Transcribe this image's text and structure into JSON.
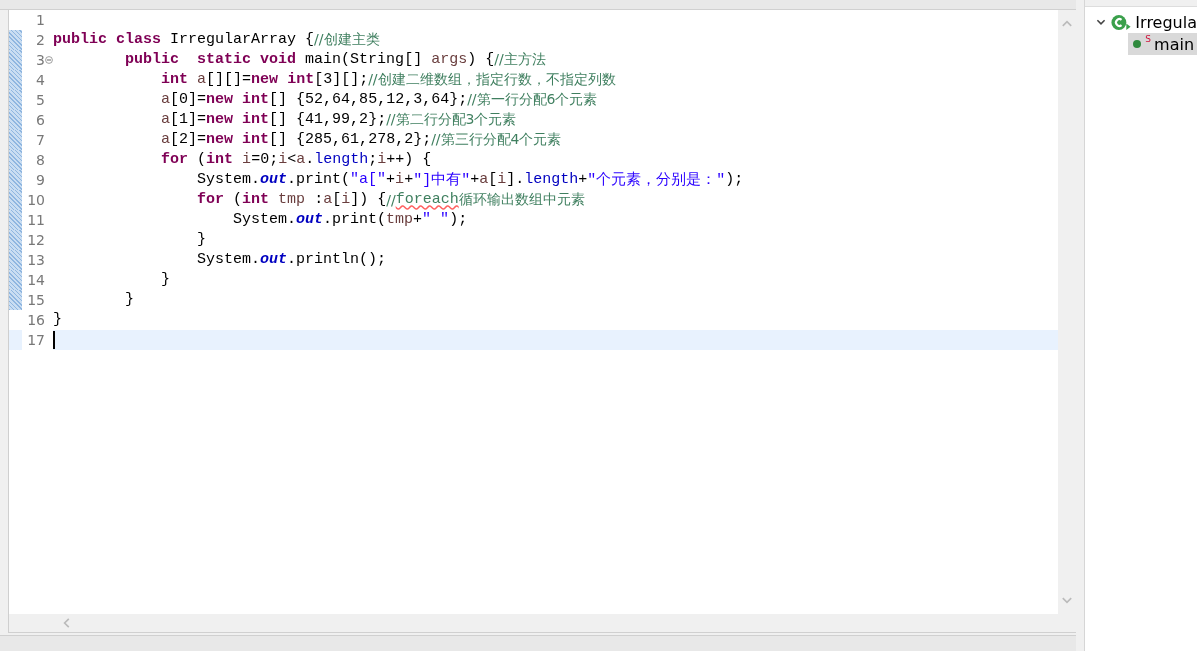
{
  "editor": {
    "lines": [
      {
        "number": "1",
        "changed": false,
        "fold": false,
        "current": false
      },
      {
        "number": "2",
        "changed": true,
        "fold": false,
        "current": false,
        "tokens": [
          {
            "kind": "keyword",
            "text": "public"
          },
          {
            "kind": "keyword",
            "text": " class"
          },
          {
            "kind": "plain",
            "text": " IrregularArray {"
          },
          {
            "kind": "comment",
            "text": "//创建主类"
          }
        ]
      },
      {
        "number": "3",
        "changed": true,
        "fold": true,
        "current": false,
        "tokens": [
          {
            "kind": "keyword",
            "text": "\t\tpublic"
          },
          {
            "kind": "keyword",
            "text": "  static"
          },
          {
            "kind": "keyword",
            "text": " void"
          },
          {
            "kind": "plain",
            "text": " main(String[] "
          },
          {
            "kind": "variable",
            "text": "args"
          },
          {
            "kind": "plain",
            "text": ") {"
          },
          {
            "kind": "comment",
            "text": "//主方法"
          }
        ]
      },
      {
        "number": "4",
        "changed": true,
        "fold": false,
        "current": false,
        "tokens": [
          {
            "kind": "keyword",
            "text": "\t\t\tint"
          },
          {
            "kind": "variable",
            "text": " a"
          },
          {
            "kind": "plain",
            "text": "[][]="
          },
          {
            "kind": "keyword",
            "text": "new"
          },
          {
            "kind": "keyword",
            "text": " int"
          },
          {
            "kind": "plain",
            "text": "[3][];"
          },
          {
            "kind": "comment",
            "text": "//创建二维数组，指定行数，不指定列数"
          }
        ]
      },
      {
        "number": "5",
        "changed": true,
        "fold": false,
        "current": false,
        "tokens": [
          {
            "kind": "variable",
            "text": "\t\t\ta"
          },
          {
            "kind": "plain",
            "text": "[0]="
          },
          {
            "kind": "keyword",
            "text": "new"
          },
          {
            "kind": "keyword",
            "text": " int"
          },
          {
            "kind": "plain",
            "text": "[] {52,64,85,12,3,64};"
          },
          {
            "kind": "comment",
            "text": "//第一行分配6个元素"
          }
        ]
      },
      {
        "number": "6",
        "changed": true,
        "fold": false,
        "current": false,
        "tokens": [
          {
            "kind": "variable",
            "text": "\t\t\ta"
          },
          {
            "kind": "plain",
            "text": "[1]="
          },
          {
            "kind": "keyword",
            "text": "new"
          },
          {
            "kind": "keyword",
            "text": " int"
          },
          {
            "kind": "plain",
            "text": "[] {41,99,2};"
          },
          {
            "kind": "comment",
            "text": "//第二行分配3个元素"
          }
        ]
      },
      {
        "number": "7",
        "changed": true,
        "fold": false,
        "current": false,
        "tokens": [
          {
            "kind": "variable",
            "text": "\t\t\ta"
          },
          {
            "kind": "plain",
            "text": "[2]="
          },
          {
            "kind": "keyword",
            "text": "new"
          },
          {
            "kind": "keyword",
            "text": " int"
          },
          {
            "kind": "plain",
            "text": "[] {285,61,278,2};"
          },
          {
            "kind": "comment",
            "text": "//第三行分配4个元素"
          }
        ]
      },
      {
        "number": "8",
        "changed": true,
        "fold": false,
        "current": false,
        "tokens": [
          {
            "kind": "keyword",
            "text": "\t\t\tfor"
          },
          {
            "kind": "plain",
            "text": " ("
          },
          {
            "kind": "keyword",
            "text": "int"
          },
          {
            "kind": "variable",
            "text": " i"
          },
          {
            "kind": "plain",
            "text": "=0;"
          },
          {
            "kind": "variable",
            "text": "i"
          },
          {
            "kind": "plain",
            "text": "<"
          },
          {
            "kind": "variable",
            "text": "a"
          },
          {
            "kind": "plain",
            "text": "."
          },
          {
            "kind": "member",
            "text": "length"
          },
          {
            "kind": "plain",
            "text": ";"
          },
          {
            "kind": "variable",
            "text": "i"
          },
          {
            "kind": "plain",
            "text": "++) {"
          }
        ]
      },
      {
        "number": "9",
        "changed": true,
        "fold": false,
        "current": false,
        "tokens": [
          {
            "kind": "plain",
            "text": "\t\t\t\tSystem."
          },
          {
            "kind": "static_field",
            "text": "out"
          },
          {
            "kind": "plain",
            "text": ".print("
          },
          {
            "kind": "string",
            "text": "\"a[\""
          },
          {
            "kind": "plain",
            "text": "+"
          },
          {
            "kind": "variable",
            "text": "i"
          },
          {
            "kind": "plain",
            "text": "+"
          },
          {
            "kind": "string",
            "text": "\"]中有\""
          },
          {
            "kind": "plain",
            "text": "+"
          },
          {
            "kind": "variable",
            "text": "a"
          },
          {
            "kind": "plain",
            "text": "["
          },
          {
            "kind": "variable",
            "text": "i"
          },
          {
            "kind": "plain",
            "text": "]."
          },
          {
            "kind": "member",
            "text": "length"
          },
          {
            "kind": "plain",
            "text": "+"
          },
          {
            "kind": "string",
            "text": "\"个元素，分别是：\""
          },
          {
            "kind": "plain",
            "text": ");"
          }
        ]
      },
      {
        "number": "10",
        "changed": true,
        "fold": false,
        "current": false,
        "tokens": [
          {
            "kind": "keyword",
            "text": "\t\t\t\tfor"
          },
          {
            "kind": "plain",
            "text": " ("
          },
          {
            "kind": "keyword",
            "text": "int"
          },
          {
            "kind": "variable",
            "text": " tmp"
          },
          {
            "kind": "plain",
            "text": " :"
          },
          {
            "kind": "variable",
            "text": "a"
          },
          {
            "kind": "plain",
            "text": "["
          },
          {
            "kind": "variable",
            "text": "i"
          },
          {
            "kind": "plain",
            "text": "]) {"
          },
          {
            "kind": "comment",
            "text": "//"
          },
          {
            "kind": "misspelled",
            "text": "foreach"
          },
          {
            "kind": "comment",
            "text": "循环输出数组中元素"
          }
        ]
      },
      {
        "number": "11",
        "changed": true,
        "fold": false,
        "current": false,
        "tokens": [
          {
            "kind": "plain",
            "text": "\t\t\t\t\tSystem."
          },
          {
            "kind": "static_field",
            "text": "out"
          },
          {
            "kind": "plain",
            "text": ".print("
          },
          {
            "kind": "variable",
            "text": "tmp"
          },
          {
            "kind": "plain",
            "text": "+"
          },
          {
            "kind": "string",
            "text": "\" \""
          },
          {
            "kind": "plain",
            "text": ");"
          }
        ]
      },
      {
        "number": "12",
        "changed": true,
        "fold": false,
        "current": false,
        "tokens": [
          {
            "kind": "plain",
            "text": "\t\t\t\t}"
          }
        ]
      },
      {
        "number": "13",
        "changed": true,
        "fold": false,
        "current": false,
        "tokens": [
          {
            "kind": "plain",
            "text": "\t\t\t\tSystem."
          },
          {
            "kind": "static_field",
            "text": "out"
          },
          {
            "kind": "plain",
            "text": ".println();"
          }
        ]
      },
      {
        "number": "14",
        "changed": true,
        "fold": false,
        "current": false,
        "tokens": [
          {
            "kind": "plain",
            "text": "\t\t\t}"
          }
        ]
      },
      {
        "number": "15",
        "changed": true,
        "fold": false,
        "current": false,
        "tokens": [
          {
            "kind": "plain",
            "text": "\t\t}"
          }
        ]
      },
      {
        "number": "16",
        "changed": false,
        "fold": false,
        "current": false,
        "tokens": [
          {
            "kind": "plain",
            "text": "}"
          }
        ]
      },
      {
        "number": "17",
        "changed": false,
        "fold": false,
        "current": true
      }
    ]
  },
  "outline": {
    "items": [
      {
        "label": "Irregula",
        "expanded": true,
        "selected": false,
        "kind": "class",
        "children": [
          {
            "label": "main",
            "badge": "S",
            "selected": true,
            "kind": "method"
          }
        ]
      }
    ]
  }
}
